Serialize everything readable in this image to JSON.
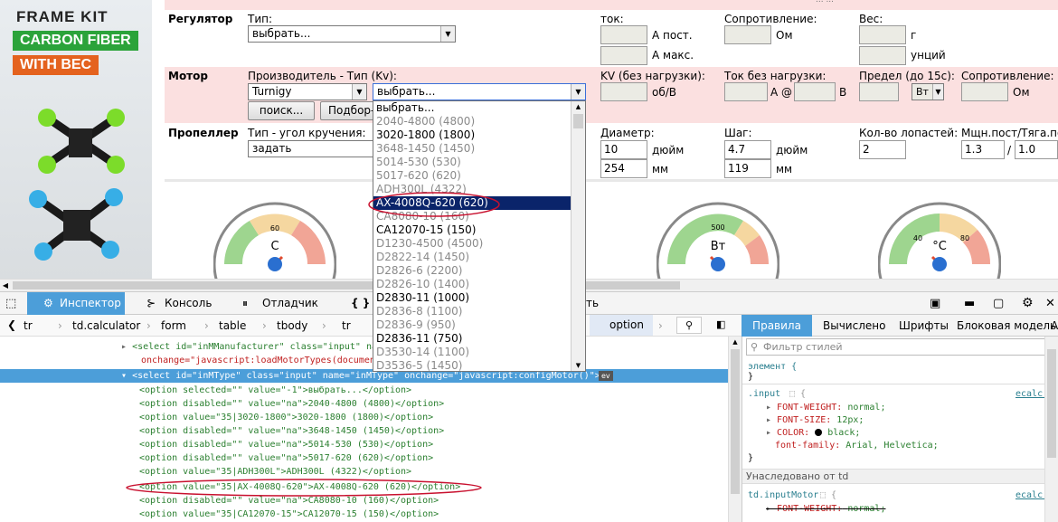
{
  "ad": {
    "line1": "FRAME KIT",
    "line2": "CARBON FIBER",
    "line3": "WITH BEC"
  },
  "calc": {
    "top_residual": "... ...",
    "regulator": {
      "label": "Регулятор",
      "type_label": "Тип:",
      "type_value": "выбрать...",
      "current_label": "ток:",
      "unit_a_cont": "А пост.",
      "unit_a_max": "А макс.",
      "resistance_label": "Сопротивление:",
      "unit_ohm": "Ом",
      "weight_label": "Вес:",
      "unit_g": "г",
      "unit_oz": "унций"
    },
    "motor": {
      "label": "Мотор",
      "manufacturer_label": "Производитель - Тип (Kv):",
      "manufacturer_value": "Turnigy",
      "type_value": "выбрать...",
      "kv_label": "KV (без нагрузки):",
      "kv_unit": "об/В",
      "noload_label": "Ток без нагрузки:",
      "noload_unit_a": "А @",
      "noload_unit_v": "В",
      "limit_label": "Предел (до 15с):",
      "limit_unit": "Вт",
      "resistance_label": "Сопротивление:",
      "resistance_unit": "Ом",
      "search_button": "поиск...",
      "select_button": "Подбор-"
    },
    "propeller": {
      "label": "Пропеллер",
      "type_label": "Тип - угол кручения:",
      "type_value": "задать",
      "diameter_label": "Диаметр:",
      "diameter_in": "10",
      "diameter_in_unit": "дюйм",
      "diameter_mm": "254",
      "diameter_mm_unit": "мм",
      "pitch_label": "Шаг:",
      "pitch_in": "4.7",
      "pitch_in_unit": "дюйм",
      "pitch_mm": "119",
      "pitch_mm_unit": "мм",
      "blades_label": "Кол-во лопастей:",
      "blades_value": "2",
      "power_label": "Мщн.пост/Тяга.пост",
      "power_value": "1.3",
      "power_sep": "/",
      "thrust_value": "1.0"
    },
    "gauges": [
      {
        "unit": "C",
        "ticks": [
          "60"
        ]
      },
      {
        "unit": "Вт",
        "ticks": [
          "500"
        ]
      },
      {
        "unit": "°C",
        "ticks": [
          "40",
          "80"
        ]
      }
    ]
  },
  "dropdown": {
    "items": [
      {
        "text": "выбрать...",
        "state": "normal"
      },
      {
        "text": "2040-4800 (4800)",
        "state": "disabled"
      },
      {
        "text": "3020-1800 (1800)",
        "state": "normal"
      },
      {
        "text": "3648-1450 (1450)",
        "state": "disabled"
      },
      {
        "text": "5014-530 (530)",
        "state": "disabled"
      },
      {
        "text": "5017-620 (620)",
        "state": "disabled"
      },
      {
        "text": "ADH300L (4322)",
        "state": "disabled"
      },
      {
        "text": "AX-4008Q-620 (620)",
        "state": "selected"
      },
      {
        "text": "CA8080-10 (160)",
        "state": "disabled"
      },
      {
        "text": "CA12070-15 (150)",
        "state": "normal"
      },
      {
        "text": "D1230-4500 (4500)",
        "state": "disabled"
      },
      {
        "text": "D2822-14 (1450)",
        "state": "disabled"
      },
      {
        "text": "D2826-6 (2200)",
        "state": "disabled"
      },
      {
        "text": "D2826-10 (1400)",
        "state": "disabled"
      },
      {
        "text": "D2830-11 (1000)",
        "state": "normal"
      },
      {
        "text": "D2836-8 (1100)",
        "state": "disabled"
      },
      {
        "text": "D2836-9 (950)",
        "state": "disabled"
      },
      {
        "text": "D2836-11 (750)",
        "state": "normal"
      },
      {
        "text": "D3530-14 (1100)",
        "state": "disabled"
      },
      {
        "text": "D3536-5 (1450)",
        "state": "disabled"
      }
    ]
  },
  "devtools": {
    "tabs": {
      "inspector": "Инспектор",
      "console": "Консоль",
      "debugger": "Отладчик",
      "style_editor": "{ }",
      "tail": "ть"
    },
    "breadcrumbs": [
      "tr",
      "td.calculator",
      "form",
      "table",
      "tbody",
      "tr",
      "option"
    ],
    "side_tabs": [
      "Правила",
      "Вычислено",
      "Шрифты",
      "Блоковая модель",
      "А"
    ],
    "filter_placeholder": "Фильтр стилей",
    "html_lines": [
      "<select id=\"inMManufacturer\" class=\"input\" na",
      "onchange=\"javascript:loadMotorTypes(document.t",
      "<select id=\"inMType\" class=\"input\" name=\"inMType\" onchange=\"javascript:configMotor()\">",
      "<option selected=\"\" value=\"-1\">выбрать...</option>",
      "<option disabled=\"\" value=\"na\">2040-4800 (4800)</option>",
      "<option value=\"35|3020-1800\">3020-1800 (1800)</option>",
      "<option disabled=\"\" value=\"na\">3648-1450 (1450)</option>",
      "<option disabled=\"\" value=\"na\">5014-530 (530)</option>",
      "<option disabled=\"\" value=\"na\">5017-620 (620)</option>",
      "<option value=\"35|ADH300L\">ADH300L (4322)</option>",
      "<option value=\"35|AX-4008Q-620\">AX-4008Q-620 (620)</option>",
      "<option disabled=\"\" value=\"na\">CA8080-10 (160)</option>",
      "<option value=\"35|CA12070-15\">CA12070-15 (150)</option>"
    ],
    "ev_badge": "ev",
    "rules": {
      "element": "элемент {",
      "close": "}",
      "input_selector": ".input",
      "input_source": "ecalc.c",
      "props": [
        {
          "name": "FONT-WEIGHT:",
          "value": "normal;"
        },
        {
          "name": "FONT-SIZE:",
          "value": "12px;"
        },
        {
          "name": "COLOR:",
          "value": "black;"
        },
        {
          "name": "font-family:",
          "value": "Arial, Helvetica;"
        }
      ],
      "inherited": "Унаследовано от td",
      "motor_selector": "td.inputMotor",
      "motor_source": "ecalc.c",
      "motor_prop_name": "FONT-WEIGHT:",
      "motor_prop_value": "normal;"
    }
  }
}
